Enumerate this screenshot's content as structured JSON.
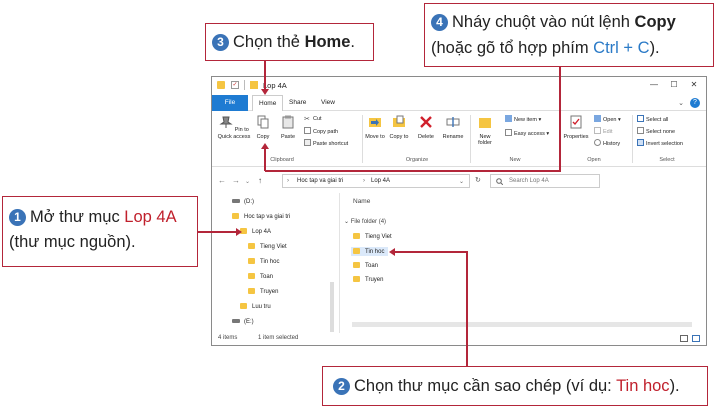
{
  "window": {
    "title": "Lop 4A",
    "tabs": [
      "File",
      "Home",
      "Share",
      "View"
    ],
    "controls": {
      "minimize": "—",
      "maximize": "☐",
      "close": "✕",
      "help": "?"
    }
  },
  "ribbon": {
    "clipboard": {
      "pin": "Pin to Quick access",
      "copy": "Copy",
      "paste": "Paste",
      "cut": "Cut",
      "copy_path": "Copy path",
      "paste_shortcut": "Paste shortcut",
      "label": "Clipboard"
    },
    "organize": {
      "move_to": "Move to",
      "copy_to": "Copy to",
      "delete": "Delete",
      "rename": "Rename",
      "label": "Organize"
    },
    "new": {
      "new_item": "New item",
      "easy_access": "Easy access",
      "new_folder": "New folder",
      "label": "New"
    },
    "open": {
      "properties": "Properties",
      "open": "Open",
      "edit": "Edit",
      "history": "History",
      "label": "Open"
    },
    "select": {
      "select_all": "Select all",
      "select_none": "Select none",
      "invert_selection": "Invert selection",
      "label": "Select"
    }
  },
  "address": {
    "crumbs": [
      "Hoc tap va giai tri",
      "Lop 4A"
    ],
    "search_placeholder": "Search Lop 4A"
  },
  "tree": [
    {
      "label": "(D:)",
      "type": "drive"
    },
    {
      "label": "Hoc tap va giai tri",
      "type": "folder"
    },
    {
      "label": "Lop 4A",
      "type": "folder"
    },
    {
      "label": "Tieng Viet",
      "type": "folder"
    },
    {
      "label": "Tin hoc",
      "type": "folder"
    },
    {
      "label": "Toan",
      "type": "folder"
    },
    {
      "label": "Truyen",
      "type": "folder"
    },
    {
      "label": "Luu tru",
      "type": "folder"
    },
    {
      "label": "(E:)",
      "type": "drive"
    }
  ],
  "content": {
    "column_name": "Name",
    "group": "File folder (4)",
    "items": [
      "Tieng Viet",
      "Tin hoc",
      "Toan",
      "Truyen"
    ],
    "selected": "Tin hoc"
  },
  "status": {
    "count": "4 items",
    "selected": "1 item selected"
  },
  "callouts": {
    "c1": {
      "num": "1",
      "before": "Mở thư mục ",
      "highlight": "Lop 4A",
      "after": "(thư mục nguồn)."
    },
    "c2": {
      "num": "2",
      "before": "Chọn thư mục cần sao chép (ví dụ: ",
      "highlight": "Tin hoc",
      "after": ")."
    },
    "c3": {
      "num": "3",
      "before": "Chọn thẻ ",
      "bold": "Home",
      "after": "."
    },
    "c4": {
      "num": "4",
      "before": "Nháy chuột vào nút lệnh ",
      "bold": "Copy",
      "line2_before": "(hoặc gõ tổ hợp phím ",
      "highlight": "Ctrl + C",
      "line2_after": ")."
    }
  },
  "colors": {
    "callout_border": "#b3263a",
    "number_badge": "#3a73b7",
    "highlight_red": "#c0202c",
    "highlight_blue": "#2a7ac7",
    "file_tab": "#1e7bd2",
    "folder": "#f5c542",
    "selection": "#dbe9fa"
  }
}
